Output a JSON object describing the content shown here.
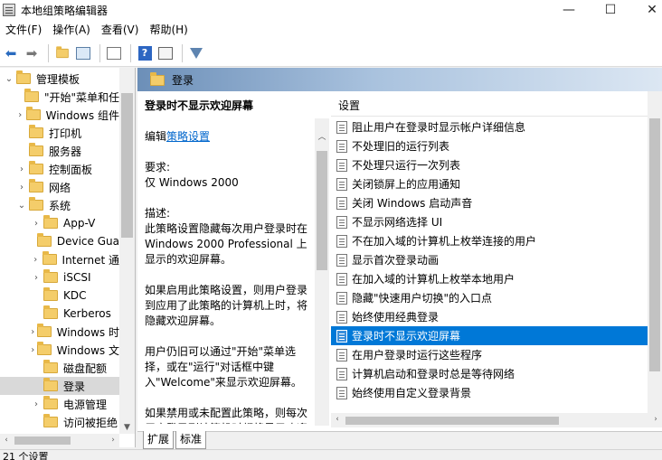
{
  "window": {
    "title": "本地组策略编辑器",
    "minimize": "—",
    "maximize": "☐",
    "close": "✕"
  },
  "menu": [
    {
      "label": "文件(F)"
    },
    {
      "label": "操作(A)"
    },
    {
      "label": "查看(V)"
    },
    {
      "label": "帮助(H)"
    }
  ],
  "toolbar": {
    "back_icon": "back-arrow-icon",
    "forward_icon": "forward-arrow-icon",
    "help_glyph": "?"
  },
  "tree": {
    "items": [
      {
        "label": "管理模板",
        "chevron": "⌄",
        "depth": 0
      },
      {
        "label": "\"开始\"菜单和任",
        "chevron": "",
        "depth": 1
      },
      {
        "label": "Windows 组件",
        "chevron": "›",
        "depth": 1
      },
      {
        "label": "打印机",
        "chevron": "",
        "depth": 1
      },
      {
        "label": "服务器",
        "chevron": "",
        "depth": 1
      },
      {
        "label": "控制面板",
        "chevron": "›",
        "depth": 1
      },
      {
        "label": "网络",
        "chevron": "›",
        "depth": 1
      },
      {
        "label": "系统",
        "chevron": "⌄",
        "depth": 1
      },
      {
        "label": "App-V",
        "chevron": "›",
        "depth": 2
      },
      {
        "label": "Device Gua",
        "chevron": "",
        "depth": 2
      },
      {
        "label": "Internet 通",
        "chevron": "›",
        "depth": 2
      },
      {
        "label": "iSCSI",
        "chevron": "›",
        "depth": 2
      },
      {
        "label": "KDC",
        "chevron": "",
        "depth": 2
      },
      {
        "label": "Kerberos",
        "chevron": "",
        "depth": 2
      },
      {
        "label": "Windows 时",
        "chevron": "›",
        "depth": 2
      },
      {
        "label": "Windows 文",
        "chevron": "›",
        "depth": 2
      },
      {
        "label": "磁盘配额",
        "chevron": "",
        "depth": 2
      },
      {
        "label": "登录",
        "chevron": "",
        "depth": 2,
        "selected": true
      },
      {
        "label": "电源管理",
        "chevron": "›",
        "depth": 2
      },
      {
        "label": "访问被拒绝",
        "chevron": "",
        "depth": 2
      }
    ]
  },
  "header": {
    "title": "登录"
  },
  "description": {
    "title": "登录时不显示欢迎屏幕",
    "edit_prefix": "编辑",
    "edit_link": "策略设置",
    "requirements_label": "要求:",
    "requirements_value": "仅 Windows 2000",
    "desc_label": "描述:",
    "para1": "此策略设置隐藏每次用户登录时在 Windows 2000 Professional 上显示的欢迎屏幕。",
    "para2": "如果启用此策略设置，则用户登录到应用了此策略的计算机上时，将隐藏欢迎屏幕。",
    "para3": "用户仍旧可以通过\"开始\"菜单选择，或在\"运行\"对话框中键入\"Welcome\"来显示欢迎屏幕。",
    "para4": "如果禁用或未配置此策略，则每次用户登录到计算机时都将显示欢迎屏幕。"
  },
  "list": {
    "column_header": "设置",
    "items": [
      {
        "label": "阻止用户在登录时显示帐户详细信息"
      },
      {
        "label": "不处理旧的运行列表"
      },
      {
        "label": "不处理只运行一次列表"
      },
      {
        "label": "关闭锁屏上的应用通知"
      },
      {
        "label": "关闭 Windows 启动声音"
      },
      {
        "label": "不显示网络选择 UI"
      },
      {
        "label": "不在加入域的计算机上枚举连接的用户"
      },
      {
        "label": "显示首次登录动画"
      },
      {
        "label": "在加入域的计算机上枚举本地用户"
      },
      {
        "label": "隐藏\"快速用户切换\"的入口点"
      },
      {
        "label": "始终使用经典登录"
      },
      {
        "label": "登录时不显示欢迎屏幕",
        "selected": true
      },
      {
        "label": "在用户登录时运行这些程序"
      },
      {
        "label": "计算机启动和登录时总是等待网络"
      },
      {
        "label": "始终使用自定义登录背景"
      }
    ]
  },
  "tabs": [
    {
      "label": "扩展",
      "active": false
    },
    {
      "label": "标准",
      "active": true
    }
  ],
  "status": {
    "text": "21 个设置"
  }
}
